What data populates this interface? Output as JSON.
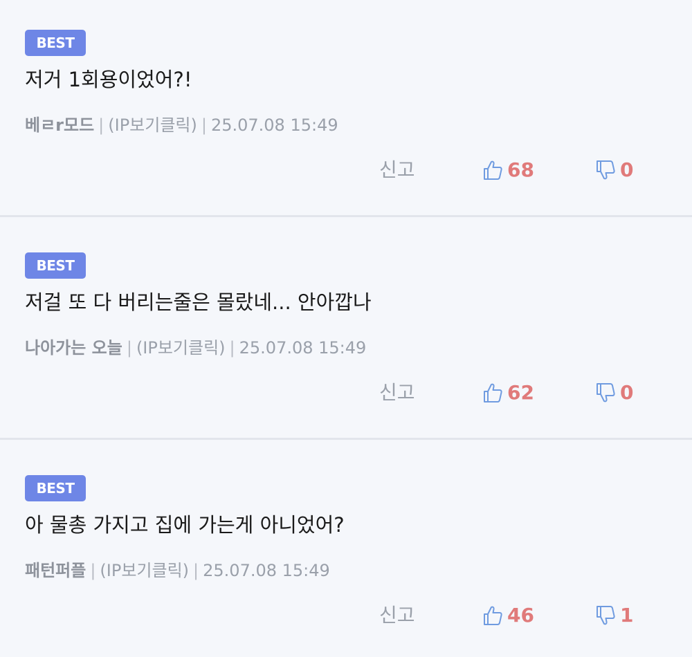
{
  "comments": [
    {
      "badge": "BEST",
      "text": "저거 1회용이었어?!",
      "author": "베ㄹr모드",
      "ip_label": "(IP보기클릭)",
      "date": "25.07.08 15:49",
      "report_label": "신고",
      "likes": "68",
      "dislikes": "0"
    },
    {
      "badge": "BEST",
      "text": "저걸 또 다 버리는줄은 몰랐네... 안아깝나",
      "author": "나아가는 오늘",
      "ip_label": "(IP보기클릭)",
      "date": "25.07.08 15:49",
      "report_label": "신고",
      "likes": "62",
      "dislikes": "0"
    },
    {
      "badge": "BEST",
      "text": "아 물총 가지고 집에 가는게 아니었어?",
      "author": "패턴퍼플",
      "ip_label": "(IP보기클릭)",
      "date": "25.07.08 15:49",
      "report_label": "신고",
      "likes": "46",
      "dislikes": "1"
    }
  ],
  "colors": {
    "badge": "#6e86e6",
    "count": "#e07a7a",
    "icon": "#6f9be0",
    "background": "#f5f7fb"
  },
  "icons": {
    "like": "thumbs-up-icon",
    "dislike": "thumbs-down-icon"
  }
}
